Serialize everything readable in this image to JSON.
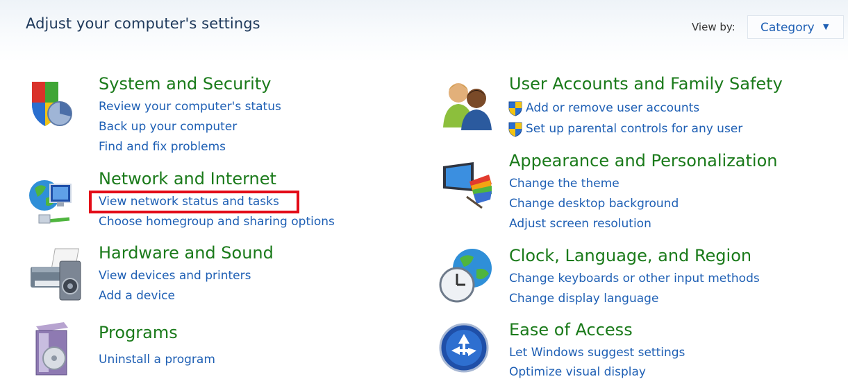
{
  "header": {
    "title": "Adjust your computer's settings",
    "view_by_label": "View by:",
    "view_by_value": "Category"
  },
  "categories": [
    {
      "title": "System and Security",
      "icon": "shield-pie-chart-icon",
      "links": [
        "Review your computer's status",
        "Back up your computer",
        "Find and fix problems"
      ]
    },
    {
      "title": "Network and Internet",
      "icon": "network-globe-icon",
      "links": [
        "View network status and tasks",
        "Choose homegroup and sharing options"
      ]
    },
    {
      "title": "Hardware and Sound",
      "icon": "printer-speaker-icon",
      "links": [
        "View devices and printers",
        "Add a device"
      ]
    },
    {
      "title": "Programs",
      "icon": "programs-box-icon",
      "links": [
        "Uninstall a program"
      ]
    },
    {
      "title": "User Accounts and Family Safety",
      "icon": "users-icon",
      "links": [
        "Add or remove user accounts",
        "Set up parental controls for any user"
      ]
    },
    {
      "title": "Appearance and Personalization",
      "icon": "monitor-palette-icon",
      "links": [
        "Change the theme",
        "Change desktop background",
        "Adjust screen resolution"
      ]
    },
    {
      "title": "Clock, Language, and Region",
      "icon": "globe-clock-icon",
      "links": [
        "Change keyboards or other input methods",
        "Change display language"
      ]
    },
    {
      "title": "Ease of Access",
      "icon": "ease-of-access-icon",
      "links": [
        "Let Windows suggest settings",
        "Optimize visual display"
      ]
    }
  ],
  "colors": {
    "title_green": "#1a7a1a",
    "link_blue": "#1e5fb4",
    "highlight_red": "#e30b17"
  }
}
